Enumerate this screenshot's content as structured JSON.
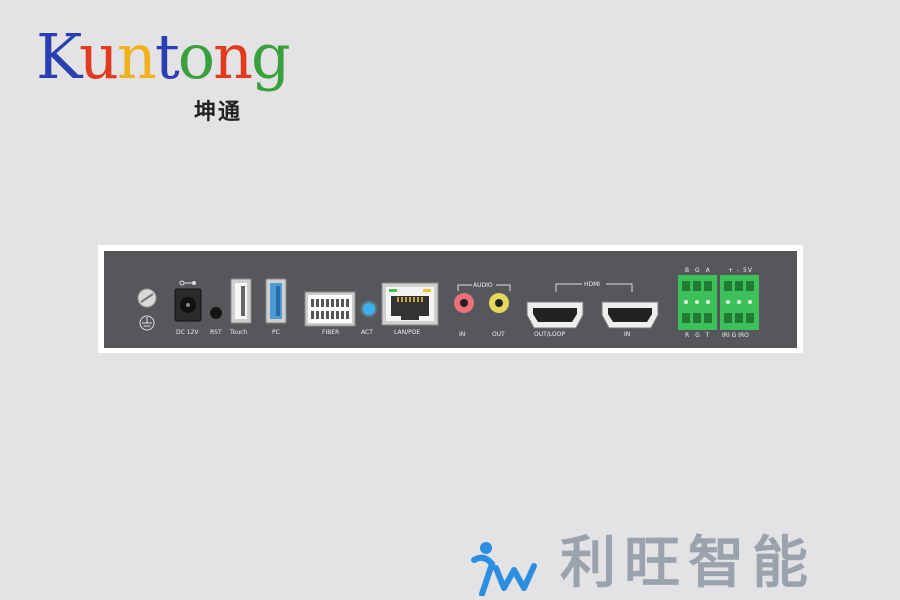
{
  "brand": {
    "letters": [
      "K",
      "u",
      "n",
      "t",
      "o",
      "n",
      "g"
    ],
    "letter_colors": [
      "#2b3fb0",
      "#e23a1e",
      "#f1b11b",
      "#2b3fb0",
      "#3aa03c",
      "#e23a1e",
      "#3aa03c"
    ],
    "chinese_name": "坤通"
  },
  "device": {
    "frame_color": "#ffffff",
    "panel_color": "#55575a",
    "ports": {
      "dc_label": "DC 12V",
      "rst_label": "RST",
      "touch_label": "Touch",
      "pc_label": "PC",
      "fiber_label": "FIBER",
      "act_label": "ACT",
      "lan_label": "LAN/POE",
      "audio_header": "AUDIO",
      "audio_in_label": "IN",
      "audio_out_label": "OUT",
      "hdmi_header": "HDMI",
      "hdmi_out_label": "OUT/LOOP",
      "hdmi_in_label": "IN",
      "terminal_top_left": "B G A",
      "terminal_top_right": "+ - 5V",
      "terminal_bottom_left": "R G T",
      "terminal_bottom_right": "IRI G IRO"
    },
    "colors": {
      "usb_blue": "#4a9ad8",
      "act_led": "#3ab0f0",
      "audio_in": "#e8707a",
      "audio_out": "#e6d85a",
      "terminal_green": "#3dc05a",
      "lan_led": "#f2c230"
    }
  },
  "watermark": {
    "text": "利旺智能",
    "color": "#9aa3ad"
  }
}
